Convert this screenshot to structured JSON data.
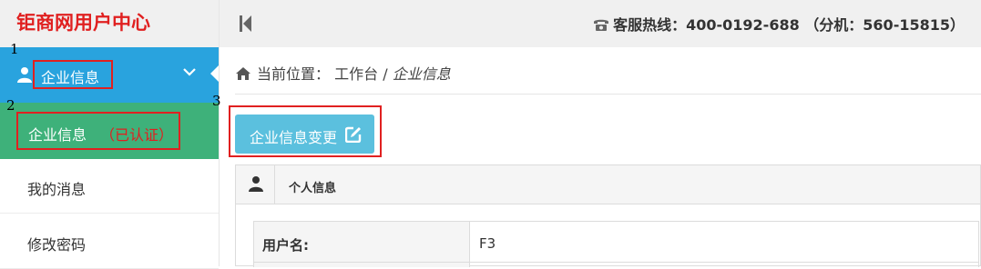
{
  "brand": {
    "title": "钜商网用户中心"
  },
  "annotations": {
    "marker_1": "1",
    "marker_2": "2",
    "marker_3": "3"
  },
  "sidebar": {
    "section": {
      "label": "企业信息",
      "icon": "user-icon",
      "expand_icon": "chevron-down-icon"
    },
    "active_item": {
      "label": "企业信息",
      "badge": "（已认证）"
    },
    "items": [
      {
        "label": "我的消息"
      },
      {
        "label": "修改密码"
      }
    ]
  },
  "topbar": {
    "collapse_icon": "collapse-left-icon",
    "phone_icon": "phone-icon",
    "hotline": "客服热线：400-0192-688 （分机：560-15815）"
  },
  "breadcrumb": {
    "home_icon": "home-icon",
    "prefix": "当前位置：",
    "root": "工作台",
    "separator": " / ",
    "current": "企业信息"
  },
  "main": {
    "change_button": {
      "label": "企业信息变更",
      "icon": "edit-icon"
    },
    "panel": {
      "icon": "user-icon",
      "title": "个人信息",
      "rows": [
        {
          "label": "用户名:",
          "value": "F3"
        }
      ]
    }
  },
  "colors": {
    "brand_red": "#e02020",
    "sidebar_blue": "#29a3de",
    "active_green": "#3eb17a",
    "button_cyan": "#5bc0de"
  }
}
